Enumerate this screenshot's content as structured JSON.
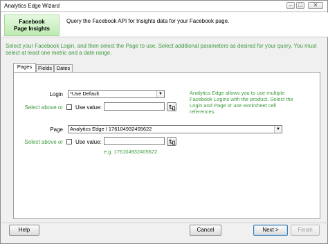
{
  "window": {
    "title": "Analytics Edge Wizard",
    "controls": {
      "minimize": "–",
      "maximize": "□",
      "close": "✕"
    }
  },
  "header": {
    "badge_line1": "Facebook",
    "badge_line2": "Page Insights",
    "description": "Query the Facebook API for Insights data for your Facebook page."
  },
  "instructions": "Select your Facebook Login, and then select the Page to use.  Select additional parameters as desired for your query. You must select at least one metric and a date range.",
  "tabs": [
    {
      "label": "Pages",
      "active": true
    },
    {
      "label": "Fields",
      "active": false
    },
    {
      "label": "Dates",
      "active": false
    }
  ],
  "login": {
    "label": "Login",
    "selected": "*Use Default",
    "select_above_or": "Select above or",
    "use_value_label": "Use value:",
    "use_value_checked": false,
    "use_value_text": "",
    "note": "Analytics Edge allows you to use multiple Facebook Logins with the product. Select the Login and Page or use worksheet cell references."
  },
  "page": {
    "label": "Page",
    "selected": "Analytics Edge / 176104932405622",
    "select_above_or": "Select above or",
    "use_value_label": "Use value:",
    "use_value_checked": false,
    "use_value_text": "",
    "example": "e.g. 176104932405622"
  },
  "buttons": {
    "help": "Help",
    "cancel": "Cancel",
    "next": "Next >",
    "finish": "Finish"
  },
  "icons": {
    "dropdown": "chevron-down-icon",
    "cell_ref": "cell-reference-icon"
  }
}
